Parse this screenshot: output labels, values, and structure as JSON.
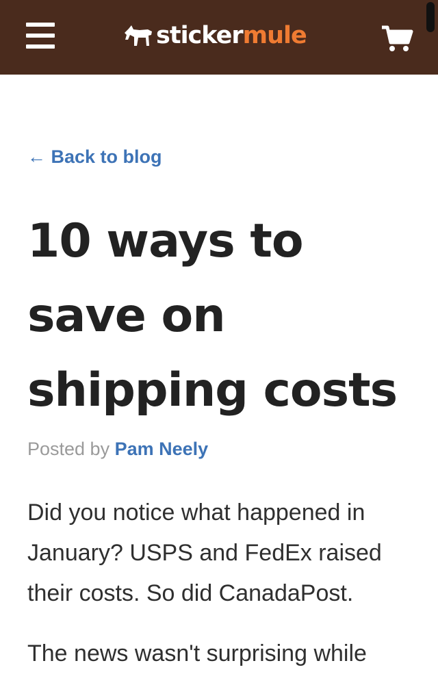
{
  "header": {
    "menu_icon": "hamburger-icon",
    "logo_icon": "mule-icon",
    "logo_word1": "sticker",
    "logo_word2": "mule",
    "cart_icon": "cart-icon",
    "colors": {
      "bar": "#4a2b1d",
      "accent": "#ef7b32"
    }
  },
  "nav": {
    "back_label": "← Back to blog"
  },
  "article": {
    "title": "10 ways to save on shipping costs",
    "byline_prefix": "Posted by",
    "author": "Pam Neely",
    "paragraph1": "Did you notice what happened in January? USPS and FedEx raised their costs. So did CanadaPost.",
    "paragraph2_partial": "The news wasn't surprising while"
  },
  "link_color": "#3d73b6"
}
